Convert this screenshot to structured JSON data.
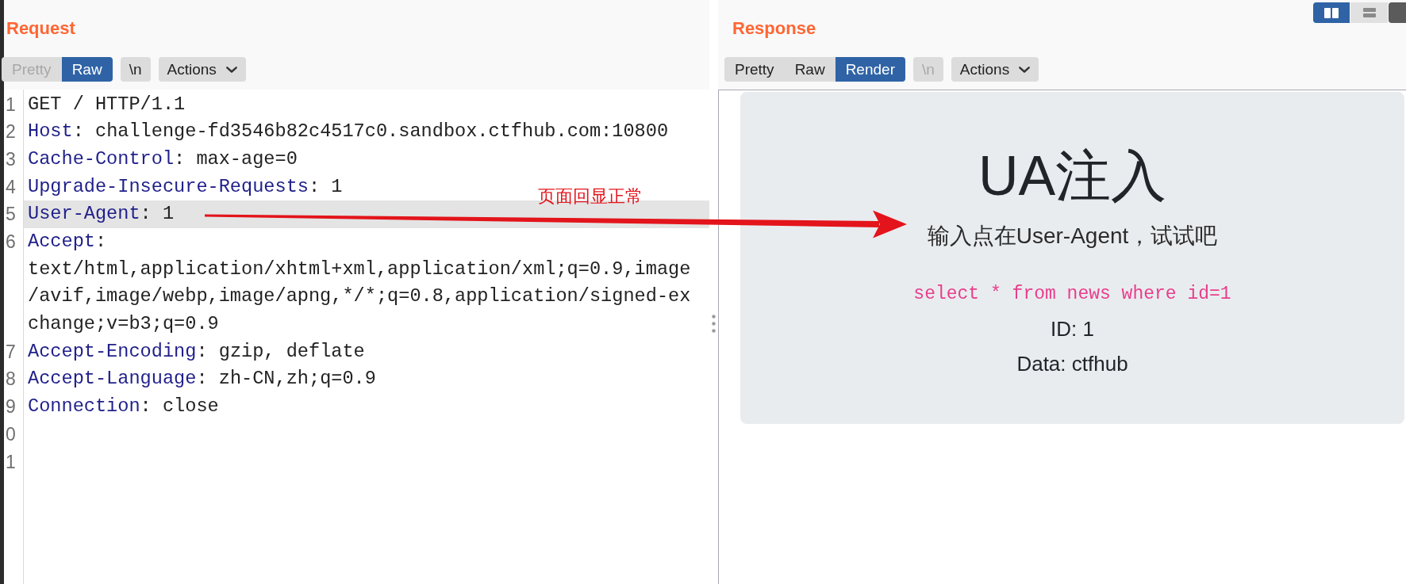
{
  "request": {
    "title": "Request",
    "tabs": [
      {
        "label": "Pretty",
        "selected": false,
        "disabled": true
      },
      {
        "label": "Raw",
        "selected": true,
        "disabled": false
      }
    ],
    "newline_button": {
      "label": "\\n",
      "disabled": false
    },
    "actions_button": {
      "label": "Actions"
    },
    "separator": ":",
    "lines": [
      {
        "number": "1",
        "kind": "request_line",
        "text": "GET / HTTP/1.1",
        "highlighted": false
      },
      {
        "number": "2",
        "kind": "header",
        "name": "Host",
        "value": "challenge-fd3546b82c4517c0.sandbox.ctfhub.com:10800",
        "highlighted": false
      },
      {
        "number": "3",
        "kind": "header",
        "name": "Cache-Control",
        "value": "max-age=0",
        "highlighted": false
      },
      {
        "number": "4",
        "kind": "header",
        "name": "Upgrade-Insecure-Requests",
        "value": "1",
        "highlighted": false
      },
      {
        "number": "5",
        "kind": "header",
        "name": "User-Agent",
        "value": "1",
        "highlighted": true
      },
      {
        "number": "6",
        "kind": "header_wrapped",
        "name": "Accept",
        "continuation": [
          "text/html,application/xhtml+xml,application/xml;q=0.9,image",
          "/avif,image/webp,image/apng,*/*;q=0.8,application/signed-ex",
          "change;v=b3;q=0.9"
        ],
        "highlighted": false
      },
      {
        "number": "7",
        "kind": "header",
        "name": "Accept-Encoding",
        "value": "gzip, deflate",
        "highlighted": false
      },
      {
        "number": "8",
        "kind": "header",
        "name": "Accept-Language",
        "value": "zh-CN,zh;q=0.9",
        "highlighted": false
      },
      {
        "number": "9",
        "kind": "header",
        "name": "Connection",
        "value": "close",
        "highlighted": false
      },
      {
        "number": "0",
        "kind": "blank",
        "highlighted": false
      },
      {
        "number": "1",
        "kind": "blank",
        "highlighted": false
      }
    ]
  },
  "annotation": {
    "text": "页面回显正常"
  },
  "response": {
    "title": "Response",
    "layout_toggle": [
      {
        "kind": "columns",
        "selected": true
      },
      {
        "kind": "rows",
        "selected": false
      }
    ],
    "tabs": [
      {
        "label": "Pretty",
        "selected": false,
        "disabled": false
      },
      {
        "label": "Raw",
        "selected": false,
        "disabled": false
      },
      {
        "label": "Render",
        "selected": true,
        "disabled": false
      }
    ],
    "newline_button": {
      "label": "\\n",
      "disabled": true
    },
    "actions_button": {
      "label": "Actions"
    },
    "render": {
      "heading": "UA注入",
      "lead": "输入点在User-Agent，试试吧",
      "query": "select * from news where id=1",
      "results": [
        "ID: 1",
        "Data: ctfhub"
      ]
    }
  }
}
